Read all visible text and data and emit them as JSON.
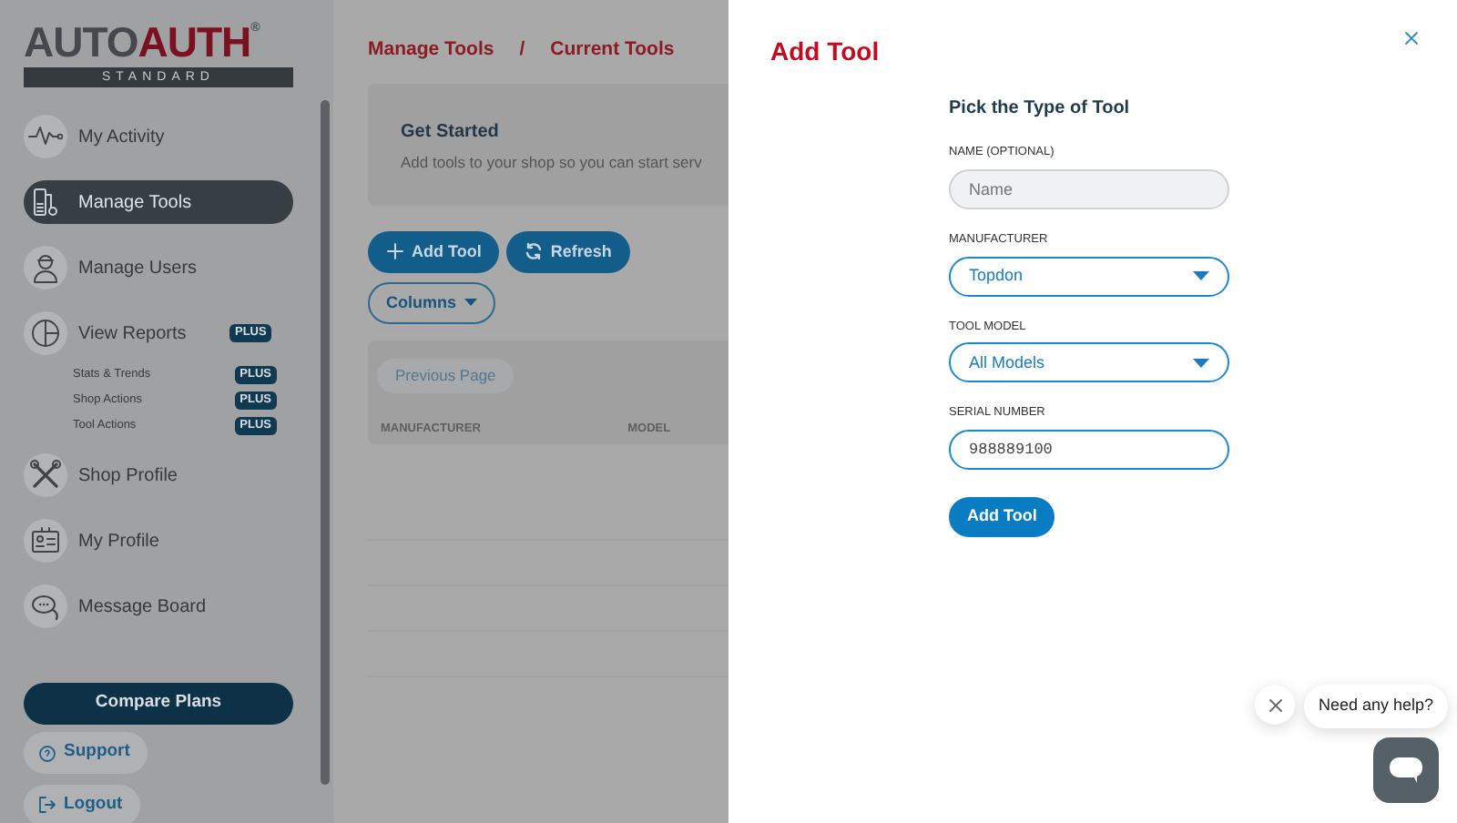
{
  "logo": {
    "left": "AUTO",
    "right": "AUTH",
    "mark": "®",
    "edition": "STANDARD"
  },
  "nav": [
    {
      "label": "My Activity",
      "selected": false
    },
    {
      "label": "Manage Tools",
      "selected": true
    },
    {
      "label": "Manage Users",
      "selected": false
    },
    {
      "label": "View Reports",
      "selected": false,
      "badge": "PLUS",
      "children": [
        {
          "label": "Stats & Trends",
          "badge": "PLUS"
        },
        {
          "label": "Shop Actions",
          "badge": "PLUS"
        },
        {
          "label": "Tool Actions",
          "badge": "PLUS"
        }
      ]
    },
    {
      "label": "Shop Profile",
      "selected": false
    },
    {
      "label": "My Profile",
      "selected": false
    },
    {
      "label": "Message Board",
      "selected": false
    }
  ],
  "compare_button": "Compare Plans",
  "footer_links": [
    "Support",
    "Logout"
  ],
  "breadcrumb": {
    "items": [
      "Manage Tools",
      "Current Tools"
    ],
    "separator": "/"
  },
  "get_started": {
    "title": "Get Started",
    "text": "Add tools to your shop so you can start serv"
  },
  "toolbar": [
    "Add Tool",
    "Refresh"
  ],
  "columns_button": "Columns",
  "table": {
    "previous_page": {
      "label": "Previous Page",
      "disabled": true
    },
    "columns": [
      "MANUFACTURER",
      "MODEL"
    ]
  },
  "dialog": {
    "title": "Add Tool",
    "heading": "Pick the Type of Tool",
    "fields": [
      {
        "label": "NAME (OPTIONAL)",
        "kind": "text",
        "placeholder": "Name"
      },
      {
        "label": "MANUFACTURER",
        "kind": "select",
        "value": "Topdon"
      },
      {
        "label": "TOOL MODEL",
        "kind": "select",
        "value": "All Models"
      },
      {
        "label": "SERIAL NUMBER",
        "kind": "text",
        "value": "988889100"
      }
    ],
    "submit": "Add Tool"
  },
  "chat": {
    "prompt": "Need any help?"
  }
}
